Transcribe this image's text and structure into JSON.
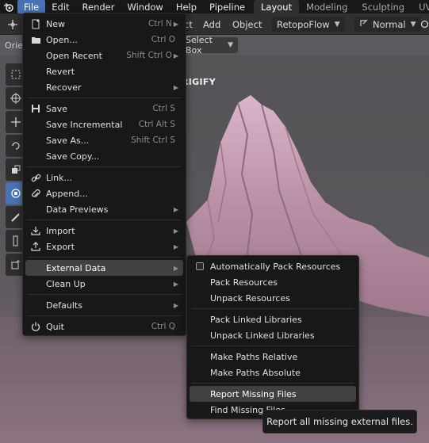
{
  "topbar": {
    "menus": [
      "File",
      "Edit",
      "Render",
      "Window",
      "Help",
      "Pipeline"
    ],
    "workspaces": [
      "Layout",
      "Modeling",
      "Sculpting",
      "UV"
    ]
  },
  "header": {
    "items": [
      "ct",
      "Add",
      "Object"
    ],
    "retopo": "RetopoFlow",
    "pivot": "Normal"
  },
  "subheader": {
    "orientation_label": "Orie",
    "select_box": "Select Box"
  },
  "viewport": {
    "overlay_label": "RIGIFY"
  },
  "file_menu": {
    "groups": [
      [
        {
          "label": "New",
          "shortcut": "Ctrl N",
          "submenu": true,
          "icon": "new-file-icon"
        },
        {
          "label": "Open...",
          "shortcut": "Ctrl O",
          "icon": "folder-icon"
        },
        {
          "label": "Open Recent",
          "shortcut": "Shift Ctrl O",
          "submenu": true
        },
        {
          "label": "Revert"
        },
        {
          "label": "Recover",
          "submenu": true
        }
      ],
      [
        {
          "label": "Save",
          "shortcut": "Ctrl S",
          "icon": "save-icon"
        },
        {
          "label": "Save Incremental",
          "shortcut": "Ctrl Alt S"
        },
        {
          "label": "Save As...",
          "shortcut": "Shift Ctrl S"
        },
        {
          "label": "Save Copy..."
        }
      ],
      [
        {
          "label": "Link...",
          "icon": "link-icon"
        },
        {
          "label": "Append...",
          "icon": "paperclip-icon"
        },
        {
          "label": "Data Previews",
          "submenu": true
        }
      ],
      [
        {
          "label": "Import",
          "submenu": true,
          "icon": "import-icon"
        },
        {
          "label": "Export",
          "submenu": true,
          "icon": "export-icon"
        }
      ],
      [
        {
          "label": "External Data",
          "submenu": true,
          "highlight": true
        },
        {
          "label": "Clean Up",
          "submenu": true
        }
      ],
      [
        {
          "label": "Defaults",
          "submenu": true
        }
      ],
      [
        {
          "label": "Quit",
          "shortcut": "Ctrl Q",
          "icon": "power-icon"
        }
      ]
    ]
  },
  "external_data_menu": {
    "groups": [
      [
        {
          "label": "Automatically Pack Resources",
          "checkbox": true,
          "checked": false
        },
        {
          "label": "Pack Resources"
        },
        {
          "label": "Unpack Resources"
        }
      ],
      [
        {
          "label": "Pack Linked Libraries"
        },
        {
          "label": "Unpack Linked Libraries"
        }
      ],
      [
        {
          "label": "Make Paths Relative"
        },
        {
          "label": "Make Paths Absolute"
        }
      ],
      [
        {
          "label": "Report Missing Files",
          "highlight": true
        },
        {
          "label": "Find Missing Files"
        }
      ]
    ]
  },
  "tooltip": {
    "text": "Report all missing external files."
  },
  "colors": {
    "accent": "#4772b3",
    "menu_bg": "#181818",
    "terrain": "#c9a5b8"
  }
}
